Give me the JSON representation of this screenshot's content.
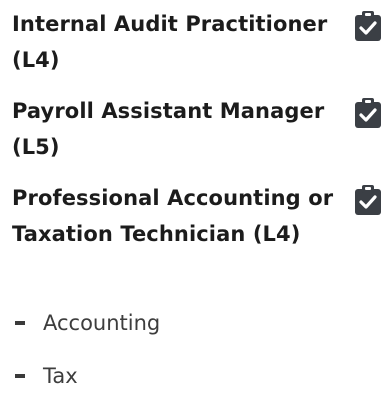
{
  "courses": [
    {
      "title": "Internal Audit Practitioner (L4)",
      "icon": "clipboard-check-icon"
    },
    {
      "title": "Payroll Assistant Manager (L5)",
      "icon": "clipboard-check-icon"
    },
    {
      "title": "Professional Accounting or Taxation Technician (L4)",
      "icon": "clipboard-check-icon"
    }
  ],
  "sub_items": [
    {
      "label": "Accounting"
    },
    {
      "label": "Tax"
    }
  ],
  "colors": {
    "icon": "#3b3f45",
    "title_text": "#1c1c1c",
    "sub_text": "#3d3d3d"
  }
}
